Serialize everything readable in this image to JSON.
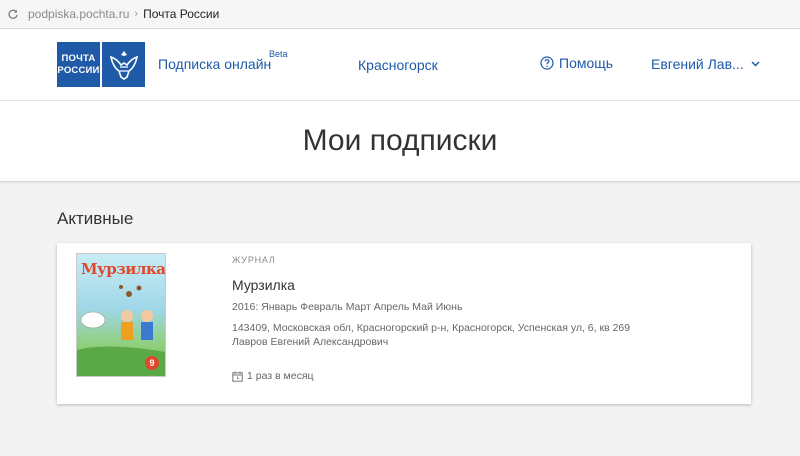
{
  "browser": {
    "url": "podpiska.pochta.ru",
    "page_title": "Почта России"
  },
  "header": {
    "logo_line1": "ПОЧТА",
    "logo_line2": "РОССИИ",
    "service": "Подписка онлайн",
    "beta": "Beta",
    "city": "Красногорск",
    "help": "Помощь",
    "user": "Евгений Лав..."
  },
  "main": {
    "title": "Мои подписки",
    "section_title": "Активные"
  },
  "subscription": {
    "kind": "ЖУРНАЛ",
    "name": "Мурзилка",
    "cover_title": "Мурзилка",
    "cover_issue": "9",
    "months": "2016: Январь Февраль Март Апрель Май Июнь",
    "address": "143409, Московская обл, Красногорский р-н, Красногорск, Успенская ул, 6, кв 269",
    "recipient": "Лавров Евгений Александрович",
    "frequency": "1 раз в месяц"
  },
  "colors": {
    "brand": "#1e5aa8",
    "background": "#f3f3f3"
  }
}
